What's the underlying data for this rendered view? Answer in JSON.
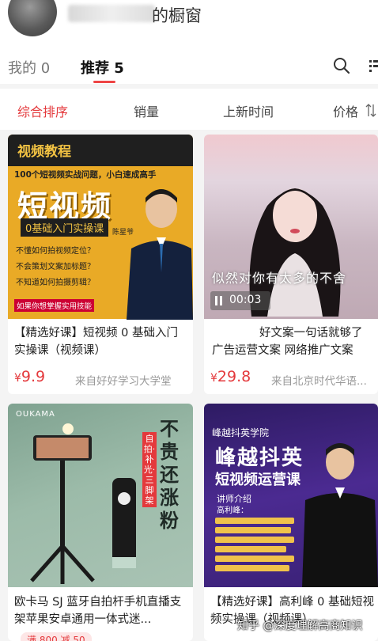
{
  "header": {
    "title_suffix": "的橱窗"
  },
  "tabs": [
    {
      "label": "我的 0"
    },
    {
      "label": "推荐 5"
    }
  ],
  "sort": {
    "items": [
      "综合排序",
      "销量",
      "上新时间",
      "价格"
    ]
  },
  "products": [
    {
      "title": "【精选好课】短视频 0 基础入门实操课（视频课）",
      "price_symbol": "¥",
      "price": "9.9",
      "shop": "来自好好学习大学堂",
      "poster": {
        "label": "视频教程",
        "headline": "100个短视频实战问题，小白速成高手",
        "big_text": "短视频",
        "subtitle": "0基础入门实操课",
        "bullets": [
          "不懂如何拍视频定位？",
          "不会策划文案加标题？",
          "不知道如何拍摄剪辑？"
        ],
        "promo": "如果你想掌握实用技能",
        "name": "陈星爷"
      }
    },
    {
      "title": "好文案一句话就够了 广告运营文案 网络推广文案",
      "price_symbol": "¥",
      "price": "29.8",
      "shop": "来自北京时代华语...",
      "poster": {
        "overlay_text": "似然对你有太多的不舍",
        "duration": "00:03"
      }
    },
    {
      "title": "欧卡马 SJ 蓝牙自拍杆手机直播支架苹果安卓通用一体式迷...",
      "original_price": "满 800 减 50",
      "poster": {
        "brand": "OUKAMA",
        "vertical_text": "不贵还涨粉",
        "tag": "自拍·补光·三脚架"
      }
    },
    {
      "title": "【精选好课】高利峰 0 基础短视频实操课（视频课）",
      "poster": {
        "school": "峰越抖英学院",
        "title": "峰越抖英",
        "subtitle": "短视频运营课",
        "intro": "讲师介绍",
        "name": "高利峰："
      }
    }
  ],
  "watermark": "知乎 @深度理解高商知识"
}
